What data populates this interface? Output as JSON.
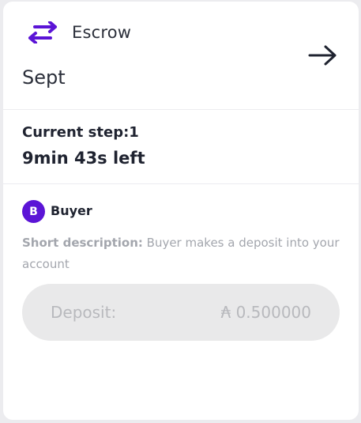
{
  "card": {
    "title": "Escrow",
    "name": "Sept",
    "icon": "swap-arrows-icon",
    "open_icon": "arrow-right-icon",
    "accent_color": "#5b14d6"
  },
  "step": {
    "label": "Current step:1",
    "time_left": "9min 43s left"
  },
  "role": {
    "avatar_letter": "B",
    "label": "Buyer",
    "description_key": "Short description:",
    "description_text": " Buyer makes a deposit into your account"
  },
  "deposit": {
    "label": "Deposit:",
    "amount": "₳ 0.500000"
  }
}
